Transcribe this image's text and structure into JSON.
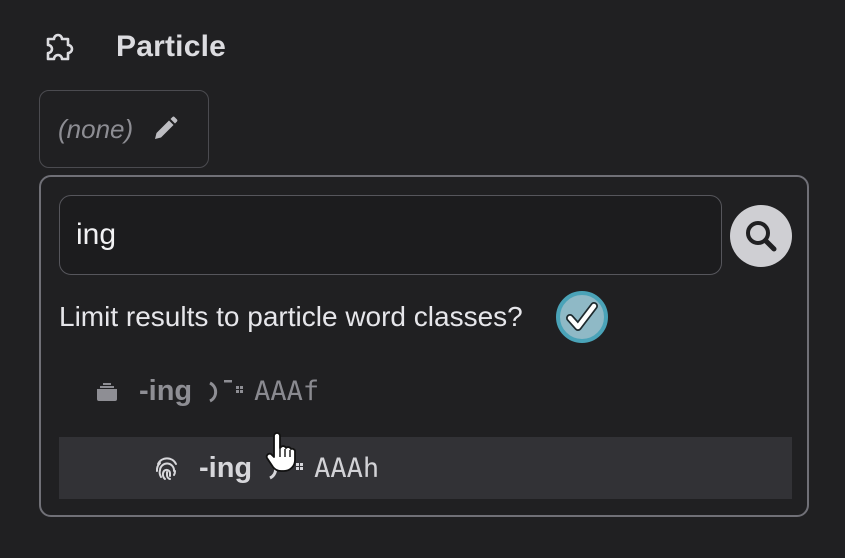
{
  "field": {
    "title": "Particle",
    "icon": "puzzle-piece-icon",
    "value_placeholder": "(none)",
    "edit_icon": "pencil-icon"
  },
  "popover": {
    "search": {
      "value": "ing",
      "button_icon": "search-icon"
    },
    "limit": {
      "label": "Limit results to particle word classes?",
      "checked": true,
      "accent": "#4aa3b8"
    },
    "results": [
      {
        "icon": "stack-icon",
        "word": "-ing",
        "glyph": "particle-glyph-icon",
        "code": "AAAf",
        "highlighted": false
      },
      {
        "icon": "fingerprint-icon",
        "word": "-ing",
        "glyph": "particle-glyph-icon",
        "code": "AAAh",
        "highlighted": true
      }
    ]
  }
}
